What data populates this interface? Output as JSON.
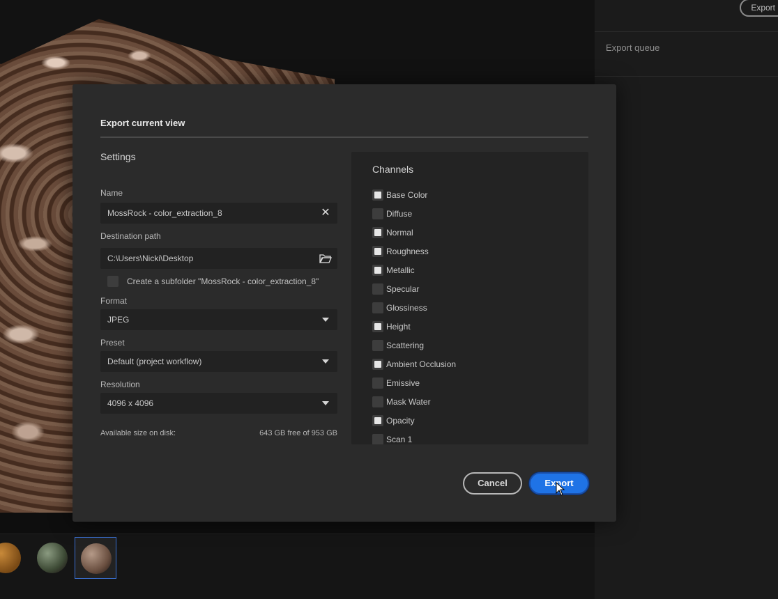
{
  "background": {
    "right_panel": {
      "export_button": "Export",
      "export_queue_label": "Export queue"
    }
  },
  "dialog": {
    "title": "Export current view",
    "settings": {
      "title": "Settings",
      "name_label": "Name",
      "name_value": "MossRock - color_extraction_8",
      "destination_label": "Destination path",
      "destination_value": "C:\\Users\\Nicki\\Desktop",
      "subfolder_label": "Create a subfolder \"MossRock - color_extraction_8\"",
      "subfolder_checked": false,
      "format_label": "Format",
      "format_value": "JPEG",
      "preset_label": "Preset",
      "preset_value": "Default (project workflow)",
      "resolution_label": "Resolution",
      "resolution_value": "4096 x 4096",
      "available_label": "Available size on disk:",
      "available_value": "643 GB free of 953 GB"
    },
    "channels": {
      "title": "Channels",
      "items": [
        {
          "label": "Base Color",
          "checked": true
        },
        {
          "label": "Diffuse",
          "checked": false
        },
        {
          "label": "Normal",
          "checked": true
        },
        {
          "label": "Roughness",
          "checked": true
        },
        {
          "label": "Metallic",
          "checked": true
        },
        {
          "label": "Specular",
          "checked": false
        },
        {
          "label": "Glossiness",
          "checked": false
        },
        {
          "label": "Height",
          "checked": true
        },
        {
          "label": "Scattering",
          "checked": false
        },
        {
          "label": "Ambient Occlusion",
          "checked": true
        },
        {
          "label": "Emissive",
          "checked": false
        },
        {
          "label": "Mask Water",
          "checked": false
        },
        {
          "label": "Opacity",
          "checked": true
        },
        {
          "label": "Scan 1",
          "checked": false
        }
      ]
    },
    "cancel_button": "Cancel",
    "export_button": "Export",
    "accent_color": "#1f73e6"
  }
}
